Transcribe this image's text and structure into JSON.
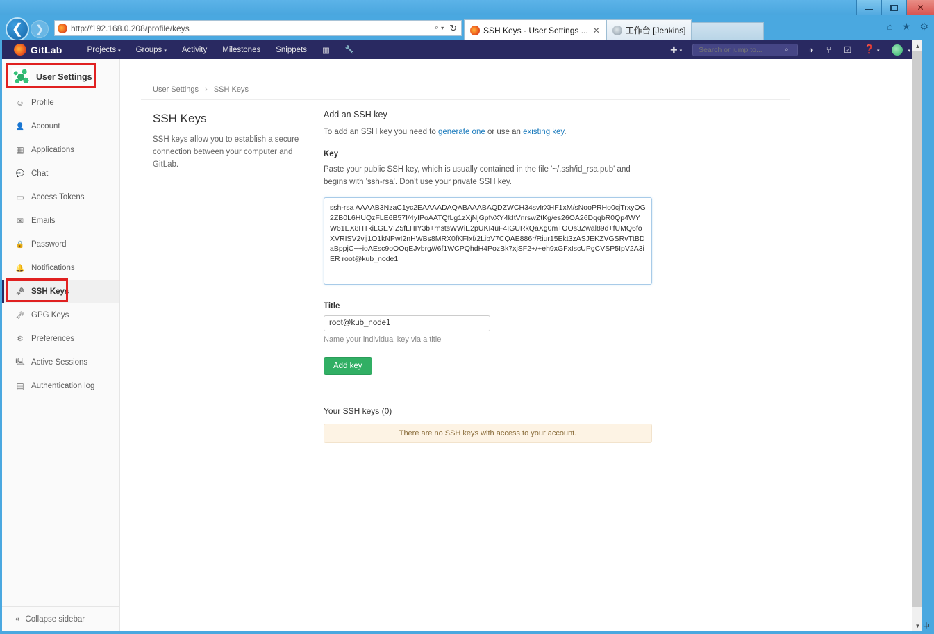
{
  "window": {
    "minimize_label": "Minimize",
    "maximize_label": "Maximize",
    "close_label": "✕"
  },
  "browser": {
    "url_protocol": "http://",
    "url_host": "192.168.0.208",
    "url_path": "/profile/keys",
    "url_full": "http://192.168.0.208/profile/keys",
    "search_icon": "⌕",
    "caret": "▾",
    "reload_icon": "↻",
    "back_icon": "❮",
    "forward_icon": "❯",
    "tabs": [
      {
        "title": "SSH Keys · User Settings ...",
        "close": "✕",
        "active": true
      },
      {
        "title": "工作台 [Jenkins]",
        "close": "",
        "active": false
      }
    ],
    "icons": {
      "home": "⌂",
      "favorites": "★",
      "settings": "⚙"
    }
  },
  "navbar": {
    "brand": "GitLab",
    "menu": [
      {
        "label": "Projects",
        "caret": "▾"
      },
      {
        "label": "Groups",
        "caret": "▾"
      },
      {
        "label": "Activity",
        "caret": ""
      },
      {
        "label": "Milestones",
        "caret": ""
      },
      {
        "label": "Snippets",
        "caret": ""
      }
    ],
    "icon_analytics": "▥",
    "icon_wrench": "🔧",
    "plus_icon": "✚",
    "plus_caret": "▾",
    "search_placeholder": "Search or jump to...",
    "search_value": "",
    "search_icon": "⌕",
    "right_icons": [
      {
        "name": "issues-icon",
        "glyph": "◑",
        "caret": ""
      },
      {
        "name": "merge-requests-icon",
        "glyph": "⑂",
        "caret": ""
      },
      {
        "name": "todos-icon",
        "glyph": "☑",
        "caret": ""
      },
      {
        "name": "help-icon",
        "glyph": "❓",
        "caret": "▾"
      }
    ],
    "avatar_caret": "▾"
  },
  "sidebar": {
    "header": "User Settings",
    "items": [
      {
        "label": "Profile",
        "icon": "☺",
        "active": false
      },
      {
        "label": "Account",
        "icon": "👤",
        "active": false
      },
      {
        "label": "Applications",
        "icon": "▦",
        "active": false
      },
      {
        "label": "Chat",
        "icon": "💬",
        "active": false
      },
      {
        "label": "Access Tokens",
        "icon": "▭",
        "active": false
      },
      {
        "label": "Emails",
        "icon": "✉",
        "active": false
      },
      {
        "label": "Password",
        "icon": "🔒",
        "active": false
      },
      {
        "label": "Notifications",
        "icon": "🔔",
        "active": false
      },
      {
        "label": "SSH Keys",
        "icon": "🗝",
        "active": true
      },
      {
        "label": "GPG Keys",
        "icon": "🗝",
        "active": false
      },
      {
        "label": "Preferences",
        "icon": "⚙",
        "active": false
      },
      {
        "label": "Active Sessions",
        "icon": "🖳",
        "active": false
      },
      {
        "label": "Authentication log",
        "icon": "▤",
        "active": false
      }
    ],
    "collapse_label": "Collapse sidebar",
    "collapse_icon": "«"
  },
  "breadcrumb": {
    "parent": "User Settings",
    "separator": "›",
    "current": "SSH Keys"
  },
  "page": {
    "title": "SSH Keys",
    "description": "SSH keys allow you to establish a secure connection between your computer and GitLab."
  },
  "form": {
    "heading": "Add an SSH key",
    "sub_prefix": "To add an SSH key you need to ",
    "link_generate": "generate one",
    "sub_middle": " or use an ",
    "link_existing": "existing key",
    "sub_suffix": ".",
    "key_label": "Key",
    "key_hint": "Paste your public SSH key, which is usually contained in the file '~/.ssh/id_rsa.pub' and begins with 'ssh-rsa'. Don't use your private SSH key.",
    "key_value": "ssh-rsa AAAAB3NzaC1yc2EAAAADAQABAAABAQDZWCH34svIrXHF1xM/sNooPRHo0cjTrxyOG2ZB0L6HUQzFLE6B57I/4yIPoAATQfLg1zXjNjGpfvXY4kItVnrswZtKg/es26OA26DqqbR0Qp4WYW61EX8HTkiLGEVIZ5fLHIY3b+rnstsWWiE2pUKI4uF4IGURkQaXg0m+OOs3Zwal89d+fUMQ6foXVRISV2vjj1O1kNPwI2nHWBs8MRX0fKFIxf/2LibV7CQAE886r/Riur15Ekt3zASJEKZVGSRvTtBDaBppjC++ioAEsc9oOOqEJvbrg///6f1WCPQhdH4PozBk7xjSF2+/+eh9xGFxIscUPgCVSP5IpV2A3iER root@kub_node1",
    "title_label": "Title",
    "title_value": "root@kub_node1",
    "title_help": "Name your individual key via a title",
    "submit_label": "Add key"
  },
  "keys_list": {
    "heading": "Your SSH keys (0)",
    "empty_message": "There are no SSH keys with access to your account."
  },
  "scrollbar": {
    "up": "▲",
    "down": "▼"
  },
  "colors": {
    "navbar_bg": "#292961",
    "accent_link": "#1b7bbd",
    "submit_green": "#31af64",
    "annotation_red": "#e02020",
    "empty_bg": "#fdf3e4"
  }
}
